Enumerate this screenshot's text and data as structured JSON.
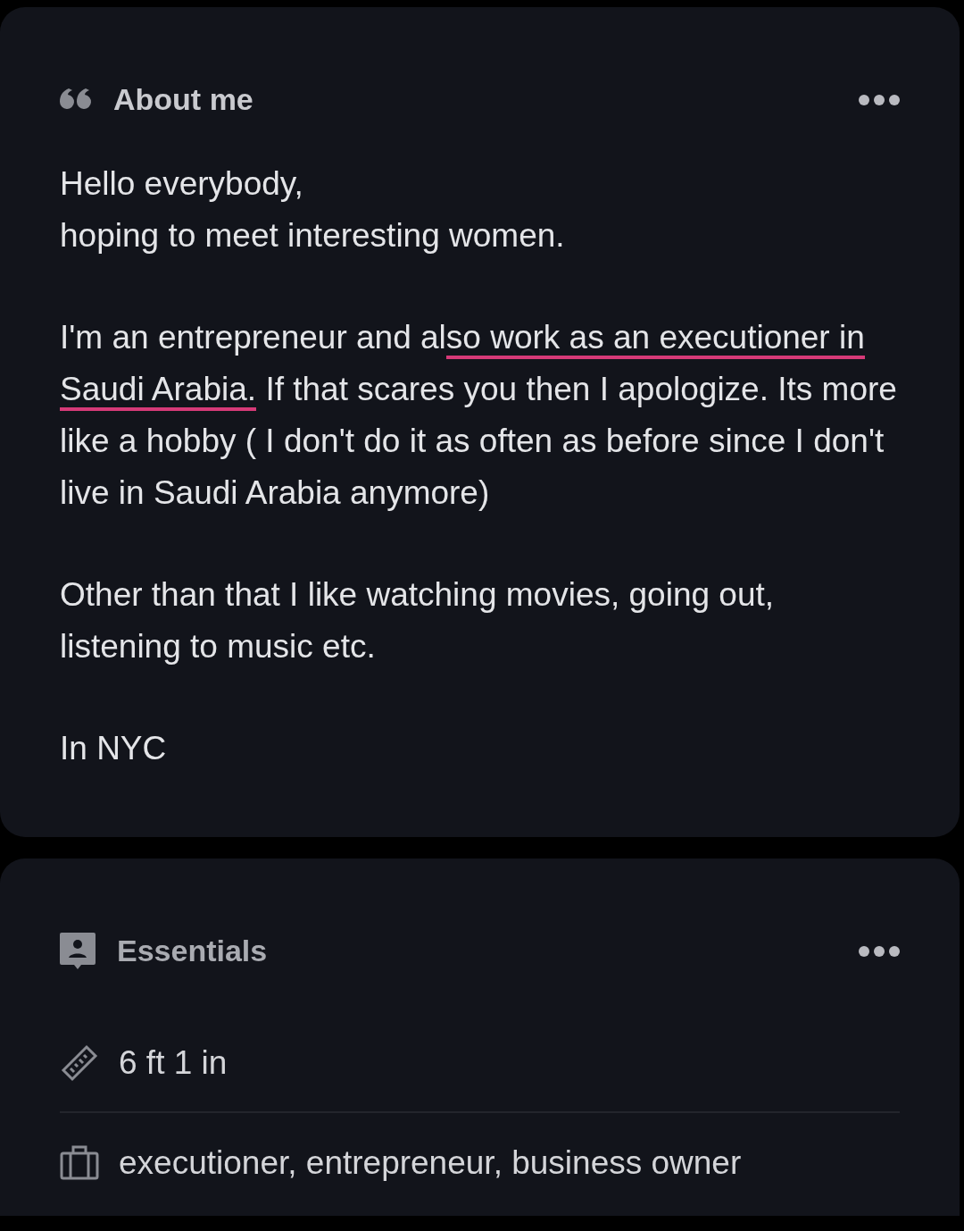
{
  "about": {
    "title": "About me",
    "paragraphs": [
      [
        {
          "text": "Hello everybody,\nhoping to meet interesting women.",
          "underlined": false
        }
      ],
      [
        {
          "text": "I'm an entrepreneur and al",
          "underlined": false
        },
        {
          "text": "so work as an executioner in Saudi Arabia.",
          "underlined": true
        },
        {
          "text": " If that scares you then I apologize. Its more like a hobby ( I don't do it as often as before since I don't live in Saudi Arabia anymore)",
          "underlined": false
        }
      ],
      [
        {
          "text": "Other than that I like watching movies, going out, listening to music etc.",
          "underlined": false
        }
      ],
      [
        {
          "text": "In NYC",
          "underlined": false
        }
      ]
    ]
  },
  "essentials": {
    "title": "Essentials",
    "items": [
      {
        "kind": "height",
        "text": "6 ft 1 in"
      },
      {
        "kind": "job",
        "text": "executioner, entrepreneur, business owner"
      }
    ]
  }
}
